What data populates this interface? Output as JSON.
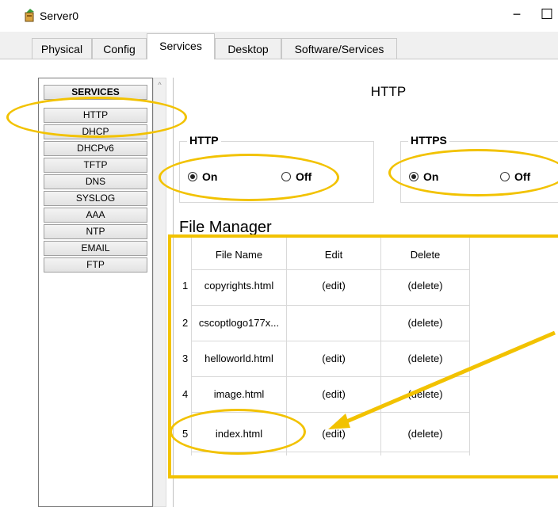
{
  "window": {
    "title": "Server0",
    "minimize_glyph": "−",
    "maximize_glyph": "☐",
    "icon": "server-app-icon"
  },
  "tabs": [
    {
      "label": "Physical",
      "active": false
    },
    {
      "label": "Config",
      "active": false
    },
    {
      "label": "Services",
      "active": true
    },
    {
      "label": "Desktop",
      "active": false
    },
    {
      "label": "Software/Services",
      "active": false
    }
  ],
  "sidebar": {
    "header": "SERVICES",
    "items": [
      "HTTP",
      "DHCP",
      "DHCPv6",
      "TFTP",
      "DNS",
      "SYSLOG",
      "AAA",
      "NTP",
      "EMAIL",
      "FTP"
    ],
    "selected": "HTTP",
    "scroll_up_glyph": "^"
  },
  "main": {
    "title": "HTTP",
    "http_group": {
      "label": "HTTP",
      "on_label": "On",
      "off_label": "Off",
      "value": "On"
    },
    "https_group": {
      "label": "HTTPS",
      "on_label": "On",
      "off_label": "Off",
      "value": "On"
    }
  },
  "file_manager": {
    "title": "File Manager",
    "columns": [
      "File Name",
      "Edit",
      "Delete"
    ],
    "rows": [
      {
        "num": "1",
        "name": "copyrights.html",
        "edit": "(edit)",
        "delete": "(delete)"
      },
      {
        "num": "2",
        "name": "cscoptlogo177x...",
        "edit": "",
        "delete": "(delete)"
      },
      {
        "num": "3",
        "name": "helloworld.html",
        "edit": "(edit)",
        "delete": "(delete)"
      },
      {
        "num": "4",
        "name": "image.html",
        "edit": "(edit)",
        "delete": "(delete)"
      },
      {
        "num": "5",
        "name": "index.html",
        "edit": "(edit)",
        "delete": "(delete)"
      }
    ]
  },
  "colors": {
    "annotation": "#f2c200",
    "tab_border": "#c8c8c8",
    "grid": "#d9d9d9"
  }
}
